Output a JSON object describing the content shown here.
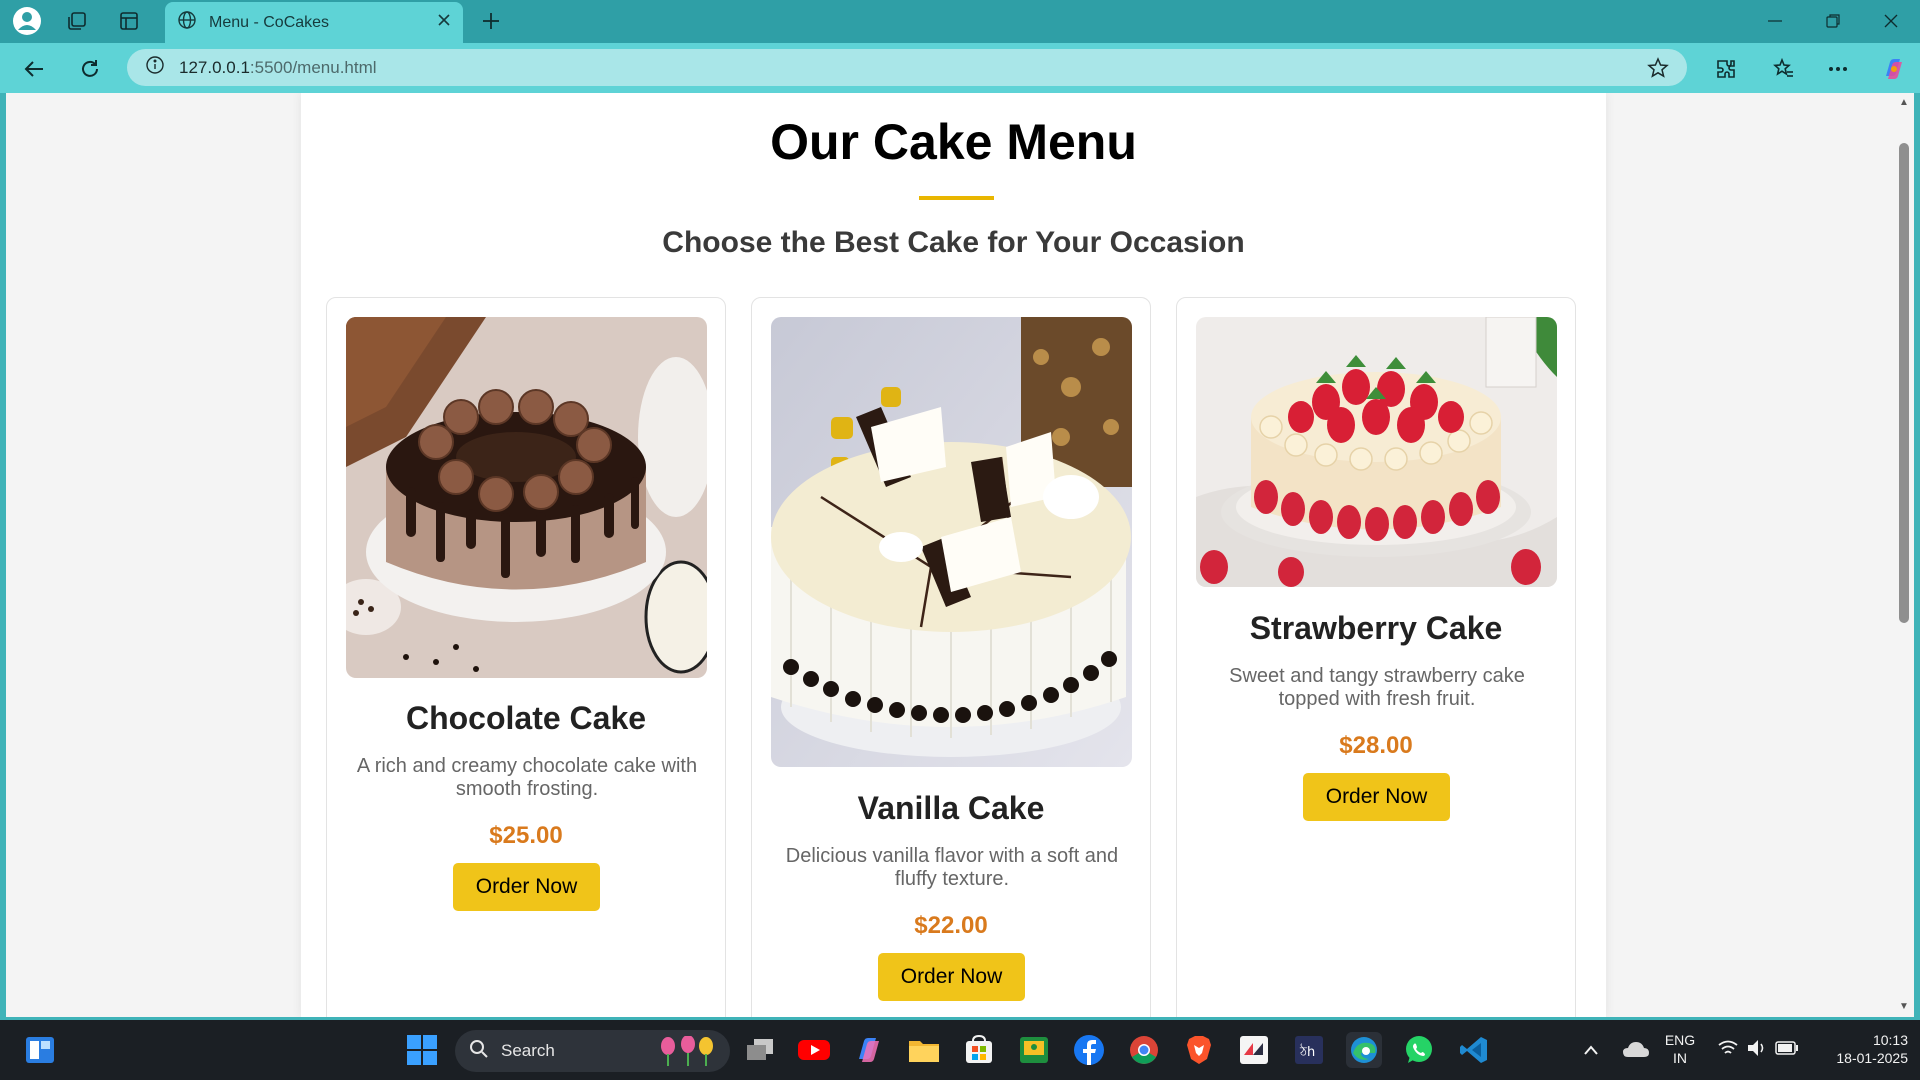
{
  "browser": {
    "tab_title": "Menu - CoCakes",
    "url_host": "127.0.0.1",
    "url_path": ":5500/menu.html"
  },
  "page": {
    "title": "Our Cake Menu",
    "subtitle": "Choose the Best Cake for Your Occasion",
    "order_label": "Order Now",
    "accent_color": "#f0c419",
    "price_color": "#d97a1d"
  },
  "cakes": [
    {
      "name": "Chocolate Cake",
      "description": "A rich and creamy chocolate cake with smooth frosting.",
      "price": "$25.00",
      "image": "chocolate-cake-photo"
    },
    {
      "name": "Vanilla Cake",
      "description": "Delicious vanilla flavor with a soft and fluffy texture.",
      "price": "$22.00",
      "image": "vanilla-cake-photo"
    },
    {
      "name": "Strawberry Cake",
      "description": "Sweet and tangy strawberry cake topped with fresh fruit.",
      "price": "$28.00",
      "image": "strawberry-cake-photo"
    }
  ],
  "taskbar": {
    "search_label": "Search",
    "language": "ENG",
    "region": "IN",
    "time": "10:13",
    "date": "18-01-2025"
  }
}
